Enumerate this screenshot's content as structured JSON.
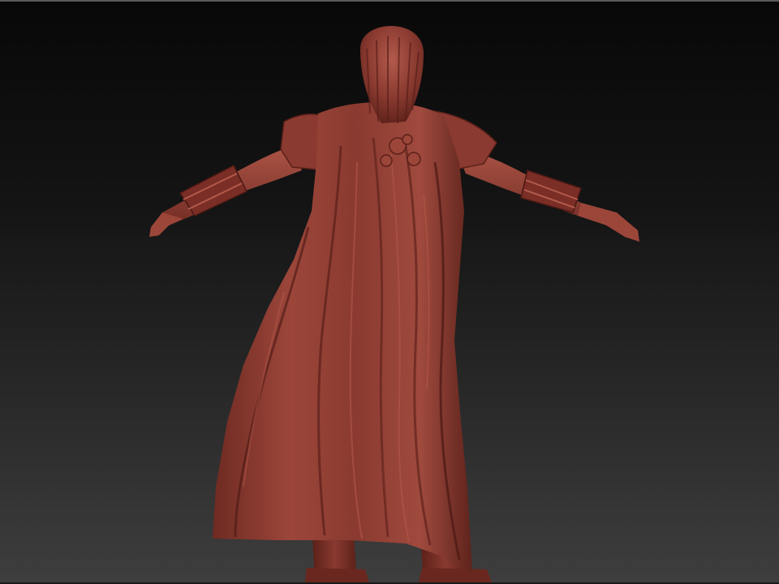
{
  "canvas": {
    "background_top_color": "#080808",
    "background_bottom_color": "#3e3e3e"
  },
  "model": {
    "subject": "figure-back-view",
    "material_base_color": "#8a3a30",
    "material_highlight_color": "#b85a4c",
    "material_shadow_color": "#4a1814"
  }
}
